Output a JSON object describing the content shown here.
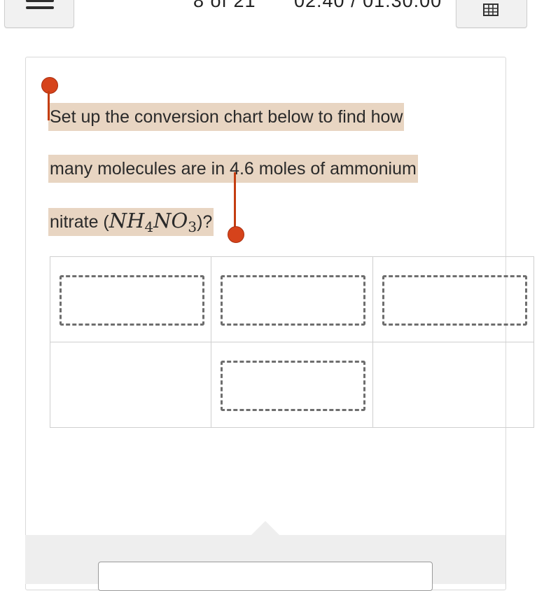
{
  "header": {
    "progress_text": "8 of 21",
    "timer_text": "02:40 / 01:30:00",
    "menu_icon": "hamburger-menu-icon",
    "calculator_icon": "table-grid-icon"
  },
  "question": {
    "text_line1": "Set up the conversion chart below to find how",
    "text_line2": "many molecules are in 4.6 moles of ammonium",
    "text_line3_prefix": "nitrate (",
    "formula_nh": "NH",
    "formula_sub4": "4",
    "formula_no": "NO",
    "formula_sub3": "3",
    "text_line3_suffix": ")?"
  },
  "chart": {
    "rows": 2,
    "columns": 3
  },
  "colors": {
    "highlight": "#e8d5c2",
    "selection_handle": "#d6431b"
  }
}
